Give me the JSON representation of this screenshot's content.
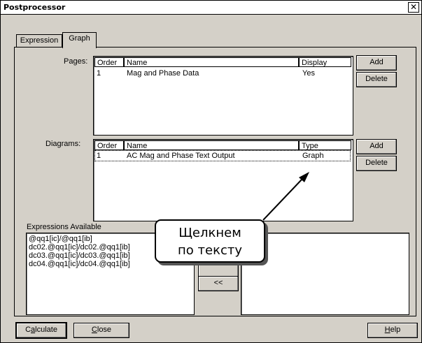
{
  "window": {
    "title": "Postprocessor",
    "close_symbol": "✕"
  },
  "tabs": [
    {
      "label": "Expression",
      "active": false
    },
    {
      "label": "Graph",
      "active": true
    }
  ],
  "pages": {
    "label": "Pages:",
    "columns": [
      "Order",
      "Name",
      "Display"
    ],
    "rows": [
      {
        "order": "1",
        "name": "Mag and Phase Data",
        "display": "Yes"
      }
    ],
    "add_label": "Add",
    "delete_label": "Delete"
  },
  "diagrams": {
    "label": "Diagrams:",
    "columns": [
      "Order",
      "Name",
      "Type"
    ],
    "rows": [
      {
        "order": "1",
        "name": "AC Mag and Phase Text Output",
        "type": "Graph"
      }
    ],
    "add_label": "Add",
    "delete_label": "Delete"
  },
  "expressions": {
    "label": "Expressions Available",
    "items": [
      "@qq1[ic]/@qq1[ib]",
      "dc02.@qq1[ic]/dc02.@qq1[ib]",
      "dc03.@qq1[ic]/dc03.@qq1[ib]",
      "dc04.@qq1[ic]/dc04.@qq1[ib]"
    ],
    "move_left_label": "<<"
  },
  "callout": {
    "line1": "Щелкнем",
    "line2": "по тексту"
  },
  "footer": {
    "calculate_pre": "C",
    "calculate_ul": "a",
    "calculate_post": "lculate",
    "close_ul": "C",
    "close_post": "lose",
    "help_ul": "H",
    "help_post": "elp"
  }
}
